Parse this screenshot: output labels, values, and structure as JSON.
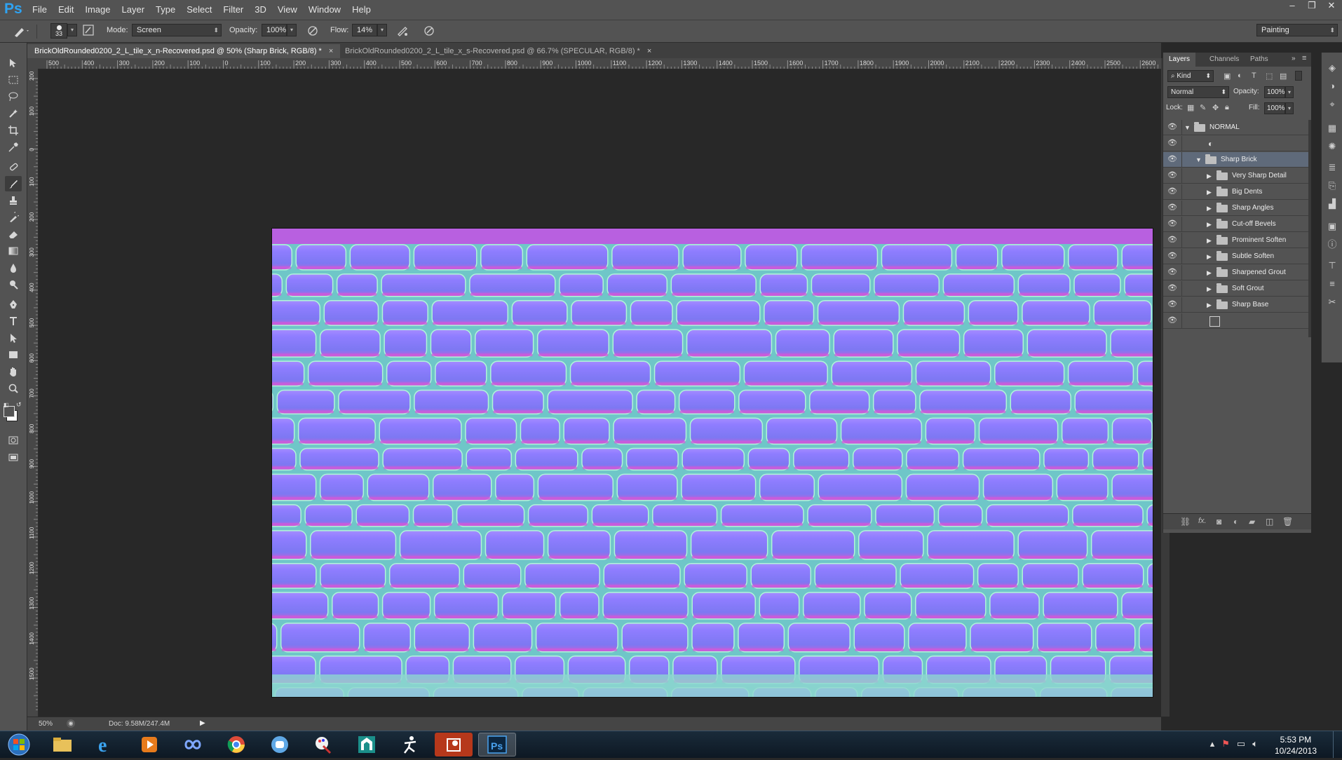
{
  "app": {
    "logo": "Ps"
  },
  "menu": [
    "File",
    "Edit",
    "Image",
    "Layer",
    "Type",
    "Select",
    "Filter",
    "3D",
    "View",
    "Window",
    "Help"
  ],
  "window_controls": [
    "–",
    "❐",
    "✕"
  ],
  "options_bar": {
    "brush_size": "33",
    "mode_label": "Mode:",
    "mode_value": "Screen",
    "opacity_label": "Opacity:",
    "opacity_value": "100%",
    "flow_label": "Flow:",
    "flow_value": "14%",
    "workspace": "Painting"
  },
  "tabs": [
    {
      "label": "BrickOldRounded0200_2_L_tile_x_n-Recovered.psd @ 50% (Sharp Brick, RGB/8) *",
      "close": "×",
      "active": true
    },
    {
      "label": "BrickOldRounded0200_2_L_tile_x_s-Recovered.psd @ 66.7% (SPECULAR, RGB/8) *",
      "close": "×",
      "active": false
    }
  ],
  "ruler": {
    "h_ticks": [
      "500",
      "400",
      "300",
      "200",
      "100",
      "0",
      "100",
      "200",
      "300",
      "400",
      "500",
      "600",
      "700",
      "800",
      "900",
      "1000",
      "1100",
      "1200",
      "1300",
      "1400",
      "1500",
      "1600",
      "1700",
      "1800",
      "1900",
      "2000",
      "2100",
      "2200",
      "2300",
      "2400",
      "2500",
      "2600"
    ],
    "v_ticks": [
      "200",
      "100",
      "0",
      "100",
      "200",
      "300",
      "400",
      "500",
      "600",
      "700",
      "800",
      "900",
      "1000",
      "1100",
      "1200",
      "1300",
      "1400",
      "1500"
    ]
  },
  "status": {
    "zoom": "50%",
    "doc": "Doc: 9.58M/247.4M"
  },
  "layers_panel": {
    "tabs": [
      "Layers",
      "Channels",
      "Paths"
    ],
    "kind_label": "Kind",
    "blend_mode": "Normal",
    "opacity_label": "Opacity:",
    "opacity_value": "100%",
    "lock_label": "Lock:",
    "fill_label": "Fill:",
    "fill_value": "100%",
    "layers": [
      {
        "name": "NORMAL",
        "type": "group",
        "indent": 0,
        "expanded": true,
        "selected": false
      },
      {
        "name": "",
        "type": "adjustment",
        "indent": 1,
        "expanded": false,
        "selected": false
      },
      {
        "name": "Sharp Brick",
        "type": "group",
        "indent": 1,
        "expanded": true,
        "selected": true
      },
      {
        "name": "Very Sharp Detail",
        "type": "group",
        "indent": 2,
        "expanded": false,
        "selected": false
      },
      {
        "name": "Big Dents",
        "type": "group",
        "indent": 2,
        "expanded": false,
        "selected": false
      },
      {
        "name": "Sharp Angles",
        "type": "group",
        "indent": 2,
        "expanded": false,
        "selected": false
      },
      {
        "name": "Cut-off Bevels",
        "type": "group",
        "indent": 2,
        "expanded": false,
        "selected": false
      },
      {
        "name": "Prominent Soften",
        "type": "group",
        "indent": 2,
        "expanded": false,
        "selected": false
      },
      {
        "name": "Subtle Soften",
        "type": "group",
        "indent": 2,
        "expanded": false,
        "selected": false
      },
      {
        "name": "Sharpened Grout",
        "type": "group",
        "indent": 2,
        "expanded": false,
        "selected": false
      },
      {
        "name": "Soft Grout",
        "type": "group",
        "indent": 2,
        "expanded": false,
        "selected": false
      },
      {
        "name": "Sharp Base",
        "type": "group",
        "indent": 2,
        "expanded": false,
        "selected": false
      },
      {
        "name": "",
        "type": "pixel",
        "indent": 1,
        "expanded": false,
        "selected": false
      }
    ]
  },
  "clock": {
    "time": "5:53 PM",
    "date": "10/24/2013"
  },
  "colors": {
    "accent_ps": "#2fa3f2",
    "selected_layer": "#5f6a7a",
    "normal_map_purple": "#8a74ff",
    "normal_map_green": "#82ffc8"
  }
}
